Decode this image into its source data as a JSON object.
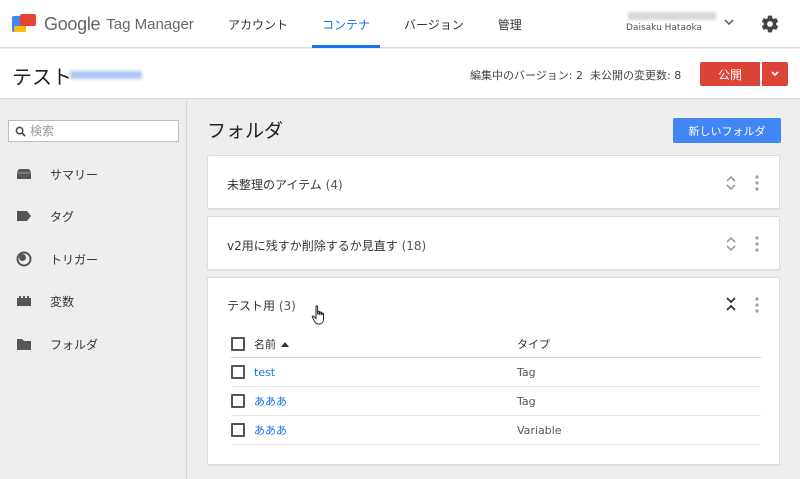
{
  "brand": {
    "google": "Google",
    "product": "Tag Manager"
  },
  "nav": {
    "tabs": [
      {
        "label": "アカウント",
        "active": false
      },
      {
        "label": "コンテナ",
        "active": true
      },
      {
        "label": "バージョン",
        "active": false
      },
      {
        "label": "管理",
        "active": false
      }
    ]
  },
  "account": {
    "name": "Daisaku Hataoka"
  },
  "container": {
    "name": "テスト",
    "editing_version": "編集中のバージョン: 2",
    "unpublished_changes": "未公開の変更数: 8",
    "publish_label": "公開"
  },
  "sidebar": {
    "search_placeholder": "検索",
    "items": [
      {
        "label": "サマリー",
        "icon": "summary-icon"
      },
      {
        "label": "タグ",
        "icon": "tag-icon"
      },
      {
        "label": "トリガー",
        "icon": "trigger-icon"
      },
      {
        "label": "変数",
        "icon": "variable-icon"
      },
      {
        "label": "フォルダ",
        "icon": "folder-icon"
      }
    ]
  },
  "main": {
    "title": "フォルダ",
    "new_folder_label": "新しいフォルダ",
    "folders": [
      {
        "name": "未整理のアイテム",
        "count": "(4)",
        "expanded": false
      },
      {
        "name": "v2用に残すか削除するか見直す",
        "count": "(18)",
        "expanded": false
      },
      {
        "name": "テスト用",
        "count": "(3)",
        "expanded": true
      }
    ],
    "table": {
      "col_name": "名前",
      "col_type": "タイプ",
      "rows": [
        {
          "name": "test",
          "type": "Tag"
        },
        {
          "name": "あああ",
          "type": "Tag"
        },
        {
          "name": "あああ",
          "type": "Variable"
        }
      ]
    }
  },
  "colors": {
    "accent": "#1a73e8",
    "publish": "#db4437",
    "new_folder": "#4285f4"
  }
}
